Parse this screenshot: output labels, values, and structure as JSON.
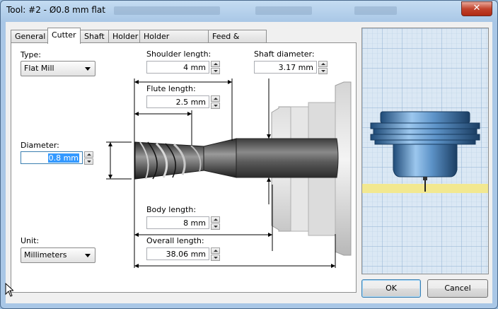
{
  "window": {
    "title": "Tool: #2 - Ø0.8 mm flat",
    "close_label": "✕"
  },
  "tabs": [
    {
      "label": "General"
    },
    {
      "label": "Cutter"
    },
    {
      "label": "Shaft"
    },
    {
      "label": "Holder"
    },
    {
      "label": "Holder Geometry"
    },
    {
      "label": "Feed & Speed"
    }
  ],
  "cutter": {
    "type_label": "Type:",
    "type_value": "Flat Mill",
    "diameter_label": "Diameter:",
    "diameter_value": "0.8 mm",
    "unit_label": "Unit:",
    "unit_value": "Millimeters",
    "shoulder_length_label": "Shoulder length:",
    "shoulder_length_value": "4 mm",
    "flute_length_label": "Flute length:",
    "flute_length_value": "2.5 mm",
    "shaft_diameter_label": "Shaft diameter:",
    "shaft_diameter_value": "3.17 mm",
    "body_length_label": "Body length:",
    "body_length_value": "8 mm",
    "overall_length_label": "Overall length:",
    "overall_length_value": "38.06 mm"
  },
  "buttons": {
    "ok": "OK",
    "cancel": "Cancel"
  },
  "colors": {
    "preview_background": "#dbe8f4",
    "holder_blue": "#4a7fb4",
    "stock_yellow": "#f2e890",
    "selection": "#3399ff"
  }
}
